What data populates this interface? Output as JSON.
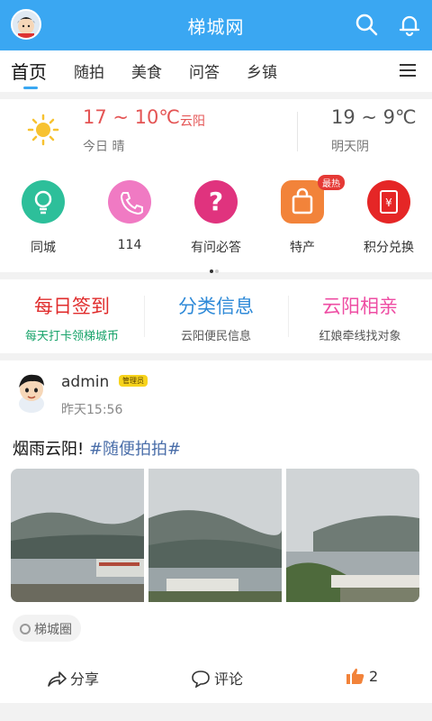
{
  "header": {
    "title": "梯城网",
    "avatar_icon": "user-avatar-icon",
    "search_icon": "search-icon",
    "bell_icon": "bell-icon"
  },
  "tabs": [
    {
      "label": "首页",
      "active": true
    },
    {
      "label": "随拍"
    },
    {
      "label": "美食"
    },
    {
      "label": "问答"
    },
    {
      "label": "乡镇"
    }
  ],
  "weather": {
    "today_temp": "17 ~ 10℃",
    "city": "云阳",
    "today_label": "今日 晴",
    "tomorrow_temp": "19 ~ 9℃",
    "tomorrow_label": "明天阴"
  },
  "shortcuts": [
    {
      "label": "同城",
      "icon": "lightbulb-icon",
      "color": "#2dbf9a"
    },
    {
      "label": "114",
      "icon": "phone-icon",
      "color": "#f07ac3"
    },
    {
      "label": "有问必答",
      "icon": "question-icon",
      "color": "#e0337e"
    },
    {
      "label": "特产",
      "icon": "shopping-bag-icon",
      "color": "#f2833a",
      "badge": "最热"
    },
    {
      "label": "积分兑换",
      "icon": "red-envelope-icon",
      "color": "#e52626"
    }
  ],
  "services": [
    {
      "title": "每日签到",
      "subtitle": "每天打卡领梯城币",
      "title_color": "#e02c2c",
      "subtitle_color": "#18a36a"
    },
    {
      "title": "分类信息",
      "subtitle": "云阳便民信息",
      "title_color": "#2f8ad8",
      "subtitle_color": "#555555"
    },
    {
      "title": "云阳相亲",
      "subtitle": "红娘牵线找对象",
      "title_color": "#ee4da3",
      "subtitle_color": "#555555"
    }
  ],
  "post": {
    "author": "admin",
    "badge": "管理员",
    "time": "昨天15:56",
    "text": "烟雨云阳! ",
    "hashtag": "#随便拍拍#",
    "circle": "梯城圈",
    "share_label": "分享",
    "comment_label": "评论",
    "like_count": "2"
  },
  "colors": {
    "brand": "#3aa7f2"
  }
}
